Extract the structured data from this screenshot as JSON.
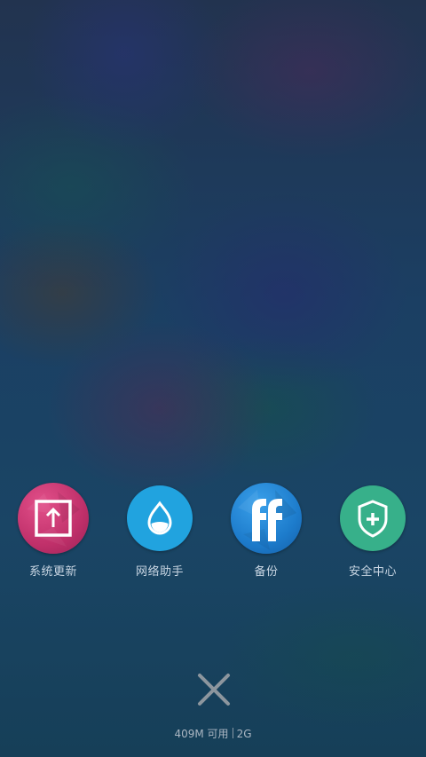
{
  "shortcuts": [
    {
      "label": "系统更新",
      "icon": "system-update-icon",
      "color": "#c8386f"
    },
    {
      "label": "网络助手",
      "icon": "water-drop-icon",
      "color": "#22a4e0"
    },
    {
      "label": "备份",
      "icon": "backup-ff-icon",
      "color": "#1f7fd0"
    },
    {
      "label": "安全中心",
      "icon": "shield-plus-icon",
      "color": "#37b08a"
    }
  ],
  "close": {
    "icon": "close-icon"
  },
  "memory": {
    "available": "409M 可用",
    "total": "2G"
  }
}
